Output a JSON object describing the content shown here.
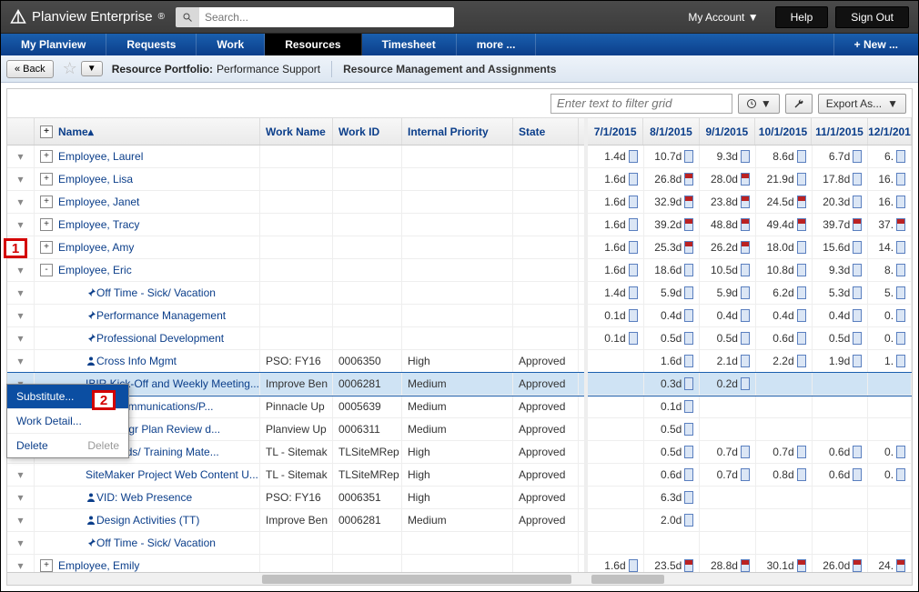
{
  "brand": "Planview Enterprise",
  "registered": "®",
  "search": {
    "placeholder": "Search..."
  },
  "top": {
    "myAccount": "My Account ▼",
    "help": "Help",
    "signOut": "Sign Out"
  },
  "nav": {
    "items": [
      "My Planview",
      "Requests",
      "Work",
      "Resources",
      "Timesheet",
      "more ..."
    ],
    "activeIndex": 3,
    "newLabel": "+ New ..."
  },
  "crumb": {
    "back": "« Back",
    "dropdown": "▼",
    "a": "Resource Portfolio:",
    "b": "Performance Support",
    "c": "Resource Management and Assignments"
  },
  "toolbar": {
    "filterPlaceholder": "Enter text to filter grid",
    "clockDrop": "▼",
    "export": "Export As...",
    "exportDrop": "▼"
  },
  "headersLeft": [
    "Name",
    "Work Name",
    "Work ID",
    "Internal Priority",
    "State"
  ],
  "headersRight": [
    "7/1/2015",
    "8/1/2015",
    "9/1/2015",
    "10/1/2015",
    "11/1/2015",
    "12/1/201"
  ],
  "rows": [
    {
      "type": "emp",
      "exp": "+",
      "name": "Employee, Laurel",
      "vals": [
        [
          "1.4d",
          0
        ],
        [
          "10.7d",
          0
        ],
        [
          "9.3d",
          0
        ],
        [
          "8.6d",
          0
        ],
        [
          "6.7d",
          0
        ],
        [
          "6.",
          0
        ]
      ]
    },
    {
      "type": "emp",
      "exp": "+",
      "name": "Employee, Lisa",
      "vals": [
        [
          "1.6d",
          0
        ],
        [
          "26.8d",
          1
        ],
        [
          "28.0d",
          1
        ],
        [
          "21.9d",
          0
        ],
        [
          "17.8d",
          0
        ],
        [
          "16.",
          0
        ]
      ]
    },
    {
      "type": "emp",
      "exp": "+",
      "name": "Employee, Janet",
      "vals": [
        [
          "1.6d",
          0
        ],
        [
          "32.9d",
          1
        ],
        [
          "23.8d",
          1
        ],
        [
          "24.5d",
          1
        ],
        [
          "20.3d",
          0
        ],
        [
          "16.",
          0
        ]
      ]
    },
    {
      "type": "emp",
      "exp": "+",
      "name": "Employee, Tracy",
      "vals": [
        [
          "1.6d",
          0
        ],
        [
          "39.2d",
          1
        ],
        [
          "48.8d",
          1
        ],
        [
          "49.4d",
          1
        ],
        [
          "39.7d",
          1
        ],
        [
          "37.",
          1
        ]
      ]
    },
    {
      "type": "emp",
      "exp": "+",
      "name": "Employee, Amy",
      "vals": [
        [
          "1.6d",
          0
        ],
        [
          "25.3d",
          1
        ],
        [
          "26.2d",
          1
        ],
        [
          "18.0d",
          0
        ],
        [
          "15.6d",
          0
        ],
        [
          "14.",
          0
        ]
      ]
    },
    {
      "type": "emp",
      "exp": "-",
      "name": "Employee, Eric",
      "vals": [
        [
          "1.6d",
          0
        ],
        [
          "18.6d",
          0
        ],
        [
          "10.5d",
          0
        ],
        [
          "10.8d",
          0
        ],
        [
          "9.3d",
          0
        ],
        [
          "8.",
          0
        ]
      ]
    },
    {
      "type": "task",
      "icon": "pin",
      "name": "Off Time - Sick/ Vacation",
      "vals": [
        [
          "1.4d",
          0
        ],
        [
          "5.9d",
          0
        ],
        [
          "5.9d",
          0
        ],
        [
          "6.2d",
          0
        ],
        [
          "5.3d",
          0
        ],
        [
          "5.",
          0
        ]
      ]
    },
    {
      "type": "task",
      "icon": "pin",
      "name": "Performance Management",
      "vals": [
        [
          "0.1d",
          0
        ],
        [
          "0.4d",
          0
        ],
        [
          "0.4d",
          0
        ],
        [
          "0.4d",
          0
        ],
        [
          "0.4d",
          0
        ],
        [
          "0.",
          0
        ]
      ]
    },
    {
      "type": "task",
      "icon": "pin",
      "name": "Professional Development",
      "vals": [
        [
          "0.1d",
          0
        ],
        [
          "0.5d",
          0
        ],
        [
          "0.5d",
          0
        ],
        [
          "0.6d",
          0
        ],
        [
          "0.5d",
          0
        ],
        [
          "0.",
          0
        ]
      ]
    },
    {
      "type": "task",
      "icon": "person",
      "name": "Cross Info Mgmt",
      "work": "PSO: FY16",
      "wid": "0006350",
      "pri": "High",
      "state": "Approved",
      "vals": [
        null,
        [
          "1.6d",
          0
        ],
        [
          "2.1d",
          0
        ],
        [
          "2.2d",
          0
        ],
        [
          "1.9d",
          0
        ],
        [
          "1.",
          0
        ]
      ]
    },
    {
      "type": "task",
      "icon": "person",
      "name": "IBIR Kick-Off and Weekly Meeting...",
      "work": "Improve Ben",
      "wid": "0006281",
      "pri": "Medium",
      "state": "Approved",
      "sel": true,
      "vals": [
        null,
        [
          "0.3d",
          0
        ],
        [
          "0.2d",
          0
        ],
        null,
        null,
        null
      ]
    },
    {
      "type": "task",
      "icon": "person",
      "name": "4.x Communications/P...",
      "work": "Pinnacle Up",
      "wid": "0005639",
      "pri": "Medium",
      "state": "Approved",
      "vals": [
        null,
        [
          "0.1d",
          0
        ],
        null,
        null,
        null,
        null
      ]
    },
    {
      "type": "task",
      "icon": "person",
      "name": "1.4 Upgr Plan Review d...",
      "work": "Planview Up",
      "wid": "0006311",
      "pri": "Medium",
      "state": "Approved",
      "vals": [
        null,
        [
          "0.5d",
          0
        ],
        null,
        null,
        null,
        null
      ]
    },
    {
      "type": "task",
      "icon": "person",
      "name": "Job Aids/ Training Mate...",
      "work": "TL - Sitemak",
      "wid": "TLSiteMRep",
      "pri": "High",
      "state": "Approved",
      "vals": [
        null,
        [
          "0.5d",
          0
        ],
        [
          "0.7d",
          0
        ],
        [
          "0.7d",
          0
        ],
        [
          "0.6d",
          0
        ],
        [
          "0.",
          0
        ]
      ]
    },
    {
      "type": "task",
      "icon": "person",
      "name": "SiteMaker Project Web Content U...",
      "work": "TL - Sitemak",
      "wid": "TLSiteMRep",
      "pri": "High",
      "state": "Approved",
      "vals": [
        null,
        [
          "0.6d",
          0
        ],
        [
          "0.7d",
          0
        ],
        [
          "0.8d",
          0
        ],
        [
          "0.6d",
          0
        ],
        [
          "0.",
          0
        ]
      ]
    },
    {
      "type": "task",
      "icon": "person",
      "name": "VID: Web Presence",
      "work": "PSO: FY16",
      "wid": "0006351",
      "pri": "High",
      "state": "Approved",
      "vals": [
        null,
        [
          "6.3d",
          0
        ],
        null,
        null,
        null,
        null
      ]
    },
    {
      "type": "task",
      "icon": "person",
      "name": "Design Activities (TT)",
      "work": "Improve Ben",
      "wid": "0006281",
      "pri": "Medium",
      "state": "Approved",
      "vals": [
        null,
        [
          "2.0d",
          0
        ],
        null,
        null,
        null,
        null
      ]
    },
    {
      "type": "task",
      "icon": "pin",
      "name": "Off Time - Sick/ Vacation",
      "vals": [
        null,
        null,
        null,
        null,
        null,
        null
      ]
    },
    {
      "type": "emp",
      "exp": "+",
      "name": "Employee, Emily",
      "vals": [
        [
          "1.6d",
          0
        ],
        [
          "23.5d",
          1
        ],
        [
          "28.8d",
          1
        ],
        [
          "30.1d",
          1
        ],
        [
          "26.0d",
          1
        ],
        [
          "24.",
          1
        ]
      ]
    }
  ],
  "contextMenu": {
    "items": [
      "Substitute...",
      "Work Detail...",
      "Delete"
    ],
    "shortcut2": "Delete"
  },
  "callouts": {
    "one": "1",
    "two": "2"
  }
}
